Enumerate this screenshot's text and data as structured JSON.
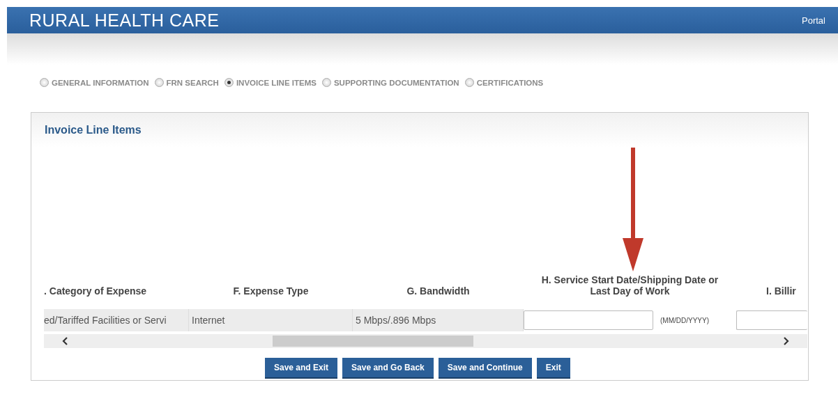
{
  "header": {
    "title": "RURAL HEALTH CARE",
    "link": "Portal"
  },
  "steps": [
    {
      "label": "GENERAL INFORMATION",
      "selected": false
    },
    {
      "label": "FRN SEARCH",
      "selected": false
    },
    {
      "label": "INVOICE LINE ITEMS",
      "selected": true
    },
    {
      "label": "SUPPORTING DOCUMENTATION",
      "selected": false
    },
    {
      "label": "CERTIFICATIONS",
      "selected": false
    }
  ],
  "panel": {
    "title": "Invoice Line Items",
    "table": {
      "columns": [
        {
          "label": ". Category of Expense",
          "kind": "cut"
        },
        {
          "label": "F. Expense Type",
          "kind": "center"
        },
        {
          "label": "G. Bandwidth",
          "kind": "center"
        },
        {
          "label": "H. Service Start Date/Shipping Date or Last Day of Work",
          "kind": "wide"
        },
        {
          "label": "I. Billir",
          "kind": "cut"
        }
      ],
      "row": {
        "category": "ed/Tariffed Facilities or Servi",
        "expense_type": "Internet",
        "bandwidth": "5 Mbps/.896 Mbps",
        "date_hint": "(MM/DD/YYYY)"
      }
    },
    "buttons": [
      "Save and Exit",
      "Save and Go Back",
      "Save and Continue",
      "Exit"
    ]
  }
}
